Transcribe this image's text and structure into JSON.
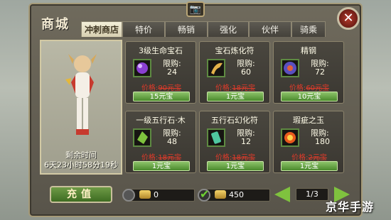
{
  "window": {
    "title": "商城",
    "close_label": "✕",
    "camera_label": "📷"
  },
  "tabs": [
    {
      "label": "冲刺商店",
      "active": true
    },
    {
      "label": "特价",
      "active": false
    },
    {
      "label": "畅销",
      "active": false
    },
    {
      "label": "强化",
      "active": false
    },
    {
      "label": "伙伴",
      "active": false
    },
    {
      "label": "骑乘",
      "active": false
    }
  ],
  "promo": {
    "remaining_label": "剩余时间",
    "remaining_time": "6天23小时58分19秒"
  },
  "items": [
    {
      "name": "3级生命宝石",
      "limit_label": "限购:",
      "limit": "24",
      "price_label": "价格:",
      "old_price": "90元宝",
      "buy_label": "15元宝",
      "icon": "purple-gem-icon",
      "icon_color": "#8a3fd1"
    },
    {
      "name": "宝石炼化符",
      "limit_label": "限购:",
      "limit": "60",
      "price_label": "价格:",
      "old_price": "18元宝",
      "buy_label": "1元宝",
      "icon": "horn-scroll-icon",
      "icon_color": "#e3b24a"
    },
    {
      "name": "精钢",
      "limit_label": "限购:",
      "limit": "72",
      "price_label": "价格:",
      "old_price": "60元宝",
      "buy_label": "10元宝",
      "icon": "steel-orb-icon",
      "icon_color": "#5a4fbf"
    },
    {
      "name": "一级五行石·木",
      "limit_label": "限购:",
      "limit": "48",
      "price_label": "价格:",
      "old_price": "18元宝",
      "buy_label": "1元宝",
      "icon": "green-stone-icon",
      "icon_color": "#7fc23e"
    },
    {
      "name": "五行石幻化符",
      "limit_label": "限购:",
      "limit": "12",
      "price_label": "价格:",
      "old_price": "18元宝",
      "buy_label": "1元宝",
      "icon": "jade-talisman-icon",
      "icon_color": "#4fc7a0"
    },
    {
      "name": "瑕疵之玉",
      "limit_label": "限购:",
      "limit": "180",
      "price_label": "价格:",
      "old_price": "2元宝",
      "buy_label": "1元宝",
      "icon": "fire-jade-icon",
      "icon_color": "#e85a1e"
    }
  ],
  "footer": {
    "recharge_label": "充值",
    "currency1": "0",
    "currency2": "450",
    "page": "1/3"
  },
  "watermark": "京华手游"
}
